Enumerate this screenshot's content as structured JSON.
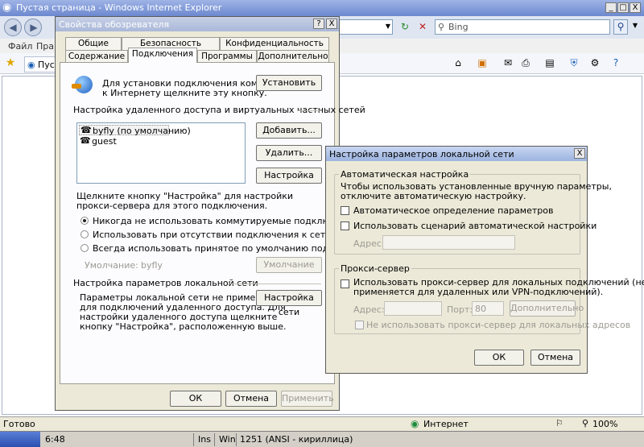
{
  "ie": {
    "title": "Пустая страница - Windows Internet Explorer",
    "window_controls": {
      "minimize": "_",
      "maximize": "□",
      "close": "X"
    },
    "search_placeholder": "Bing",
    "menu": [
      "Файл",
      "Правка"
    ],
    "fav_tab": "Пуст",
    "status_text": "Готово",
    "zone": "Интернет",
    "zoom": "100%"
  },
  "editor_status": {
    "time": "6:48",
    "ins": "Ins",
    "win": "Win",
    "encoding": "1251 (ANSI - кириллица)"
  },
  "inet_props": {
    "title": "Свойства обозревателя",
    "help": "?",
    "close": "X",
    "tabs_row1": [
      "Общие",
      "Безопасность",
      "Конфиденциальность"
    ],
    "tabs_row2": [
      "Содержание",
      "Подключения",
      "Программы",
      "Дополнительно"
    ],
    "setup_text_1": "Для установки подключения компьютера",
    "setup_text_2": "к Интернету щелкните эту кнопку.",
    "setup_button": "Установить",
    "dialup_header": "Настройка удаленного доступа и виртуальных частных сетей",
    "connections": [
      "byfly (по умолчанию)",
      "guest"
    ],
    "add_button": "Добавить...",
    "remove_button": "Удалить...",
    "settings_button": "Настройка",
    "proxy_hint_1": "Щелкните кнопку \"Настройка\" для настройки",
    "proxy_hint_2": "прокси-сервера для этого подключения.",
    "radio_options": [
      "Никогда не использовать коммутируемые подключения",
      "Использовать при отсутствии подключения к сети",
      "Всегда использовать принятое по умолчанию подключение"
    ],
    "default_label": "Умолчание:",
    "default_value": "byfly",
    "default_button": "Умолчание",
    "lan_header": "Настройка параметров локальной сети",
    "lan_text": [
      "Параметры локальной сети не применяются",
      "для подключений удаленного доступа. Для",
      "настройки удаленного доступа щелкните",
      "кнопку \"Настройка\", расположенную выше."
    ],
    "lan_button": "Настройка сети",
    "ok": "ОК",
    "cancel": "Отмена",
    "apply": "Применить"
  },
  "lan_dialog": {
    "title": "Настройка параметров локальной сети",
    "close": "X",
    "auto_group": "Автоматическая настройка",
    "auto_text_1": "Чтобы использовать установленные вручную параметры,",
    "auto_text_2": "отключите автоматическую настройку.",
    "auto_detect": "Автоматическое определение параметров",
    "auto_script": "Использовать сценарий автоматической настройки",
    "address_label": "Адрес",
    "proxy_group": "Прокси-сервер",
    "proxy_use_1": "Использовать прокси-сервер для локальных подключений (не",
    "proxy_use_2": "применяется для удаленных или VPN-подключений).",
    "proxy_address_label": "Адрес:",
    "port_label": "Порт:",
    "port_value": "80",
    "advanced_button": "Дополнительно",
    "bypass_local": "Не использовать прокси-сервер для локальных адресов",
    "ok": "ОК",
    "cancel": "Отмена"
  }
}
